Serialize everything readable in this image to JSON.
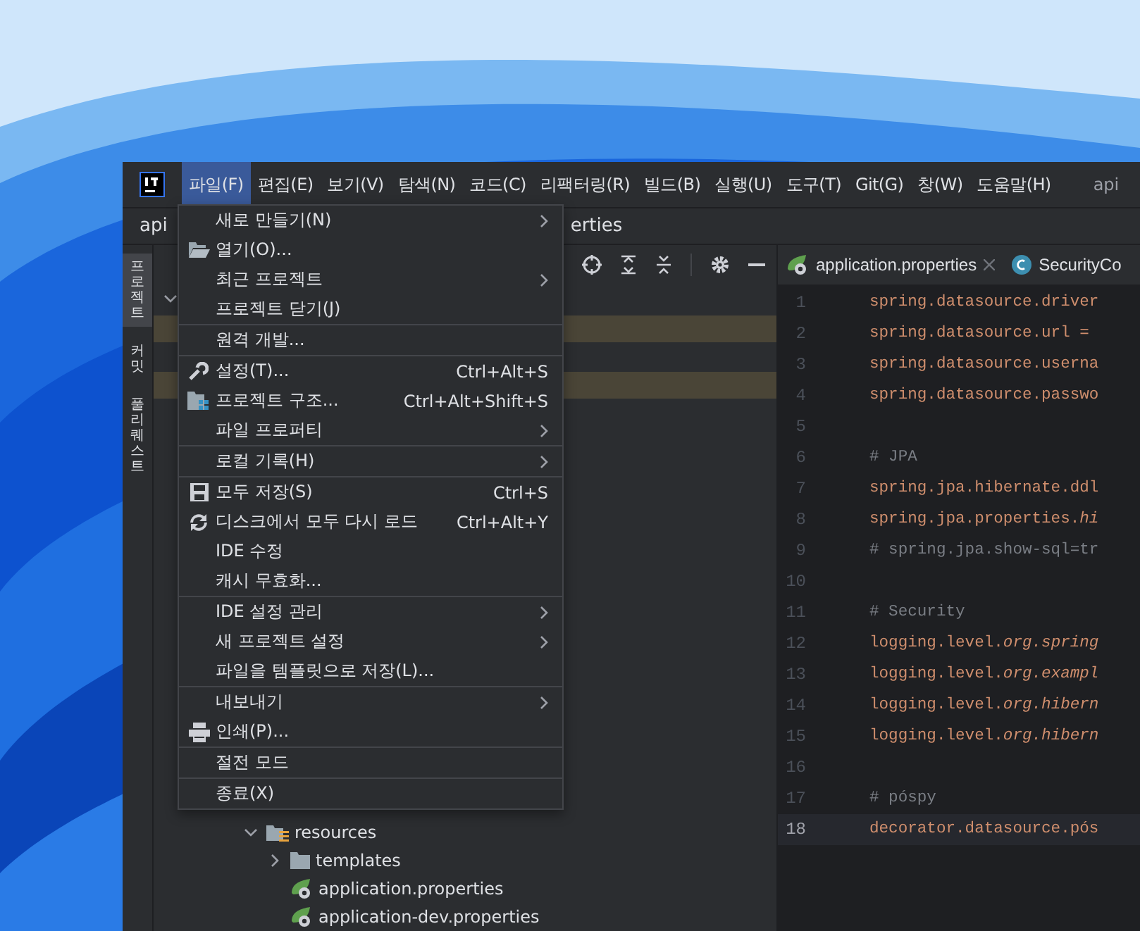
{
  "menubar": {
    "items": [
      {
        "label": "파일(F)",
        "selected": true
      },
      {
        "label": "편집(E)",
        "selected": false
      },
      {
        "label": "보기(V)",
        "selected": false
      },
      {
        "label": "탐색(N)",
        "selected": false
      },
      {
        "label": "코드(C)",
        "selected": false
      },
      {
        "label": "리팩터링(R)",
        "selected": false
      },
      {
        "label": "빌드(B)",
        "selected": false
      },
      {
        "label": "실행(U)",
        "selected": false
      },
      {
        "label": "도구(T)",
        "selected": false
      },
      {
        "label": "Git(G)",
        "selected": false
      },
      {
        "label": "창(W)",
        "selected": false
      },
      {
        "label": "도움말(H)",
        "selected": false
      }
    ],
    "title": "api"
  },
  "breadcrumb": {
    "project": "api",
    "file": "erties"
  },
  "side_tabs": [
    {
      "label": "프로젝트",
      "selected": true
    },
    {
      "label": "커밋",
      "selected": false
    },
    {
      "label": "풀 리퀘스트",
      "selected": false
    }
  ],
  "tree": [
    {
      "label": "resources",
      "kind": "resource-folder",
      "expanded": true,
      "children": [
        {
          "label": "templates",
          "kind": "folder",
          "expanded": false
        },
        {
          "label": "application.properties",
          "kind": "properties"
        },
        {
          "label": "application-dev.properties",
          "kind": "properties"
        }
      ]
    }
  ],
  "editor_tabs": [
    {
      "label": "application.properties",
      "kind": "properties",
      "closable": true
    },
    {
      "label": "SecurityCo",
      "kind": "class",
      "closable": false
    }
  ],
  "code": [
    {
      "n": "1",
      "text": "spring.datasource.driver",
      "kind": "key"
    },
    {
      "n": "2",
      "text": "spring.datasource.url =",
      "kind": "key"
    },
    {
      "n": "3",
      "text": "spring.datasource.userna",
      "kind": "key"
    },
    {
      "n": "4",
      "text": "spring.datasource.passwo",
      "kind": "key"
    },
    {
      "n": "5"
    },
    {
      "n": "6",
      "text": "# JPA",
      "kind": "comment"
    },
    {
      "n": "7",
      "text": "spring.jpa.hibernate.ddl",
      "kind": "key"
    },
    {
      "n": "8",
      "text": "spring.jpa.properties.*hi*",
      "kind": "key"
    },
    {
      "n": "9",
      "text": "# spring.jpa.show-sql=tr",
      "kind": "comment"
    },
    {
      "n": "10"
    },
    {
      "n": "11",
      "text": "# Security",
      "kind": "comment"
    },
    {
      "n": "12",
      "text": "logging.level.*org.spring*",
      "kind": "key"
    },
    {
      "n": "13",
      "text": "logging.level.*org.exampl*",
      "kind": "key"
    },
    {
      "n": "14",
      "text": "logging.level.*org.hibern*",
      "kind": "key"
    },
    {
      "n": "15",
      "text": "logging.level.*org.hibern*",
      "kind": "key"
    },
    {
      "n": "16"
    },
    {
      "n": "17",
      "text": "# póspy",
      "kind": "comment"
    },
    {
      "n": "18",
      "text": "decorator.datasource.pós",
      "kind": "key",
      "current": true
    }
  ],
  "file_menu": {
    "groups": [
      [
        {
          "label": "새로 만들기(N)",
          "submenu": true
        },
        {
          "label": "열기(O)...",
          "kind": "folder"
        },
        {
          "label": "최근 프로젝트",
          "submenu": true
        },
        {
          "label": "프로젝트 닫기(J)"
        }
      ],
      [
        {
          "label": "원격 개발..."
        }
      ],
      [
        {
          "label": "설정(T)...",
          "kind": "wrench",
          "shortcut": "Ctrl+Alt+S"
        },
        {
          "label": "프로젝트 구조...",
          "kind": "structure",
          "shortcut": "Ctrl+Alt+Shift+S"
        },
        {
          "label": "파일 프로퍼티",
          "submenu": true
        }
      ],
      [
        {
          "label": "로컬 기록(H)",
          "submenu": true
        }
      ],
      [
        {
          "label": "모두 저장(S)",
          "kind": "save",
          "shortcut": "Ctrl+S"
        },
        {
          "label": "디스크에서 모두 다시 로드",
          "kind": "reload",
          "shortcut": "Ctrl+Alt+Y"
        },
        {
          "label": "IDE 수정"
        },
        {
          "label": "캐시 무효화..."
        }
      ],
      [
        {
          "label": "IDE 설정 관리",
          "submenu": true
        },
        {
          "label": "새 프로젝트 설정",
          "submenu": true
        },
        {
          "label": "파일을 템플릿으로 저장(L)..."
        }
      ],
      [
        {
          "label": "내보내기",
          "submenu": true
        },
        {
          "label": "인쇄(P)...",
          "kind": "print"
        }
      ],
      [
        {
          "label": "절전 모드"
        }
      ],
      [
        {
          "label": "종료(X)"
        }
      ]
    ]
  }
}
